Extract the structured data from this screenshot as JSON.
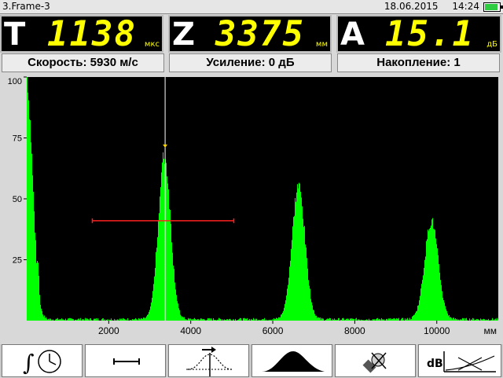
{
  "title_bar": {
    "file_name": "3.Frame-3",
    "date": "18.06.2015",
    "time": "14:24",
    "battery_level": 0.9
  },
  "readouts": [
    {
      "letter": "T",
      "value": "1138",
      "unit": "мкс"
    },
    {
      "letter": "Z",
      "value": "3375",
      "unit": "мм"
    },
    {
      "letter": "A",
      "value": "15.1",
      "unit": "дБ"
    }
  ],
  "info": {
    "speed": "Скорость: 5930 м/с",
    "gain": "Усиление: 0 дБ",
    "accumulation": "Накопление: 1"
  },
  "colors": {
    "signal": "#00ff00",
    "gate": "#ff2020",
    "cursor": "#ffffff",
    "marker": "#ffd400",
    "background": "#000000",
    "readout_digits": "#ffff00"
  },
  "chart_data": {
    "type": "area",
    "xlabel": "мм",
    "xlim": [
      0,
      11500
    ],
    "ylim": [
      0,
      100
    ],
    "x_ticks": [
      2000,
      4000,
      6000,
      8000,
      10000
    ],
    "y_ticks": [
      25,
      50,
      75,
      100
    ],
    "series": [
      {
        "peaks": [
          {
            "x": 0,
            "amplitude": 100,
            "width": 140
          },
          {
            "x": 3350,
            "amplitude": 71,
            "width": 150
          },
          {
            "x": 6620,
            "amplitude": 58,
            "width": 160
          },
          {
            "x": 9860,
            "amplitude": 43,
            "width": 165
          }
        ],
        "near_zone_echo": {
          "x": 260,
          "amplitude": 27
        }
      }
    ],
    "gate": {
      "start": 1600,
      "end": 5050,
      "level": 41
    },
    "cursor": {
      "x": 3375
    },
    "marker": {
      "x": 3375,
      "amplitude": 71
    }
  },
  "toolbar": {
    "buttons": [
      {
        "icon": "integral-clock-icon"
      },
      {
        "icon": "gate-icon"
      },
      {
        "icon": "cursor-peak-icon"
      },
      {
        "icon": "envelope-icon"
      },
      {
        "icon": "probe-off-icon"
      },
      {
        "icon": "dac-curve-icon"
      }
    ]
  }
}
